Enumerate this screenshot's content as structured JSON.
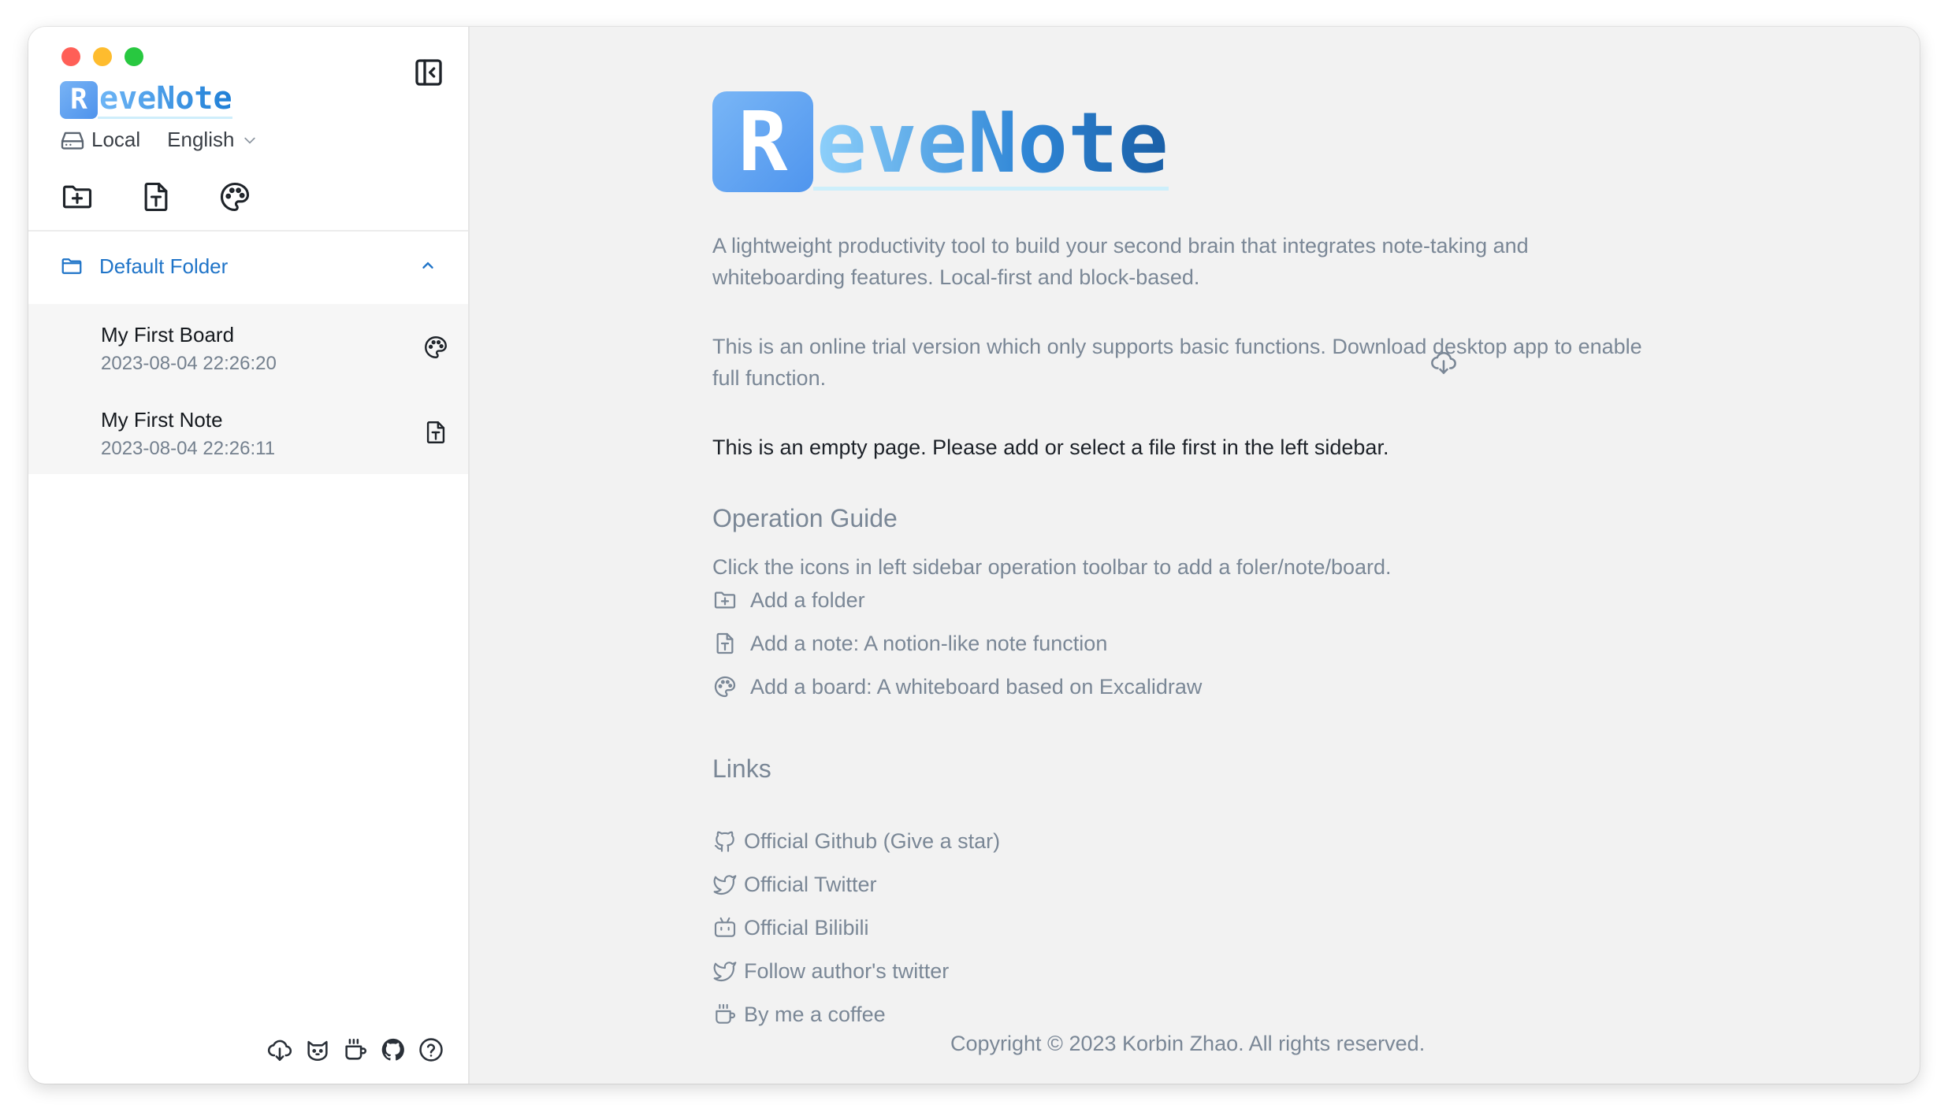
{
  "brand": {
    "initial": "R",
    "rest": "eveNote"
  },
  "sidebar": {
    "storage_label": "Local",
    "language": "English",
    "folder": {
      "name": "Default Folder"
    },
    "files": [
      {
        "title": "My First Board",
        "date": "2023-08-04 22:26:20",
        "type": "board"
      },
      {
        "title": "My First Note",
        "date": "2023-08-04 22:26:11",
        "type": "note"
      }
    ],
    "footer_icons": [
      "download-icon",
      "cat-icon",
      "coffee-icon",
      "github-icon",
      "help-icon"
    ]
  },
  "main": {
    "intro": "A lightweight productivity tool to build your second brain that integrates note-taking and whiteboarding features. Local-first and block-based.",
    "trial": "This is an online trial version which only supports basic functions. Download desktop app to enable full function.",
    "empty_page": "This is an empty page. Please add or select a file first in the left sidebar.",
    "guide": {
      "heading": "Operation Guide",
      "text": "Click the icons in left sidebar operation toolbar to add a foler/note/board.",
      "items": [
        {
          "icon": "add-folder-icon",
          "label": "Add a folder"
        },
        {
          "icon": "add-note-icon",
          "label": "Add a note: A notion-like note function"
        },
        {
          "icon": "palette-icon",
          "label": "Add a board: A whiteboard based on Excalidraw"
        }
      ]
    },
    "links": {
      "heading": "Links",
      "items": [
        {
          "icon": "github-icon",
          "label": "Official Github (Give a star)"
        },
        {
          "icon": "twitter-icon",
          "label": "Official Twitter"
        },
        {
          "icon": "bilibili-icon",
          "label": "Official Bilibili"
        },
        {
          "icon": "twitter-icon",
          "label": "Follow author's twitter"
        },
        {
          "icon": "coffee-icon",
          "label": "By me a coffee"
        }
      ]
    },
    "copyright": "Copyright © 2023 Korbin Zhao. All rights reserved."
  },
  "colors": {
    "accent": "#1f74c8",
    "logo_blue": "#4e93ec",
    "muted_text": "#7a8796",
    "main_bg": "#f2f2f2"
  }
}
